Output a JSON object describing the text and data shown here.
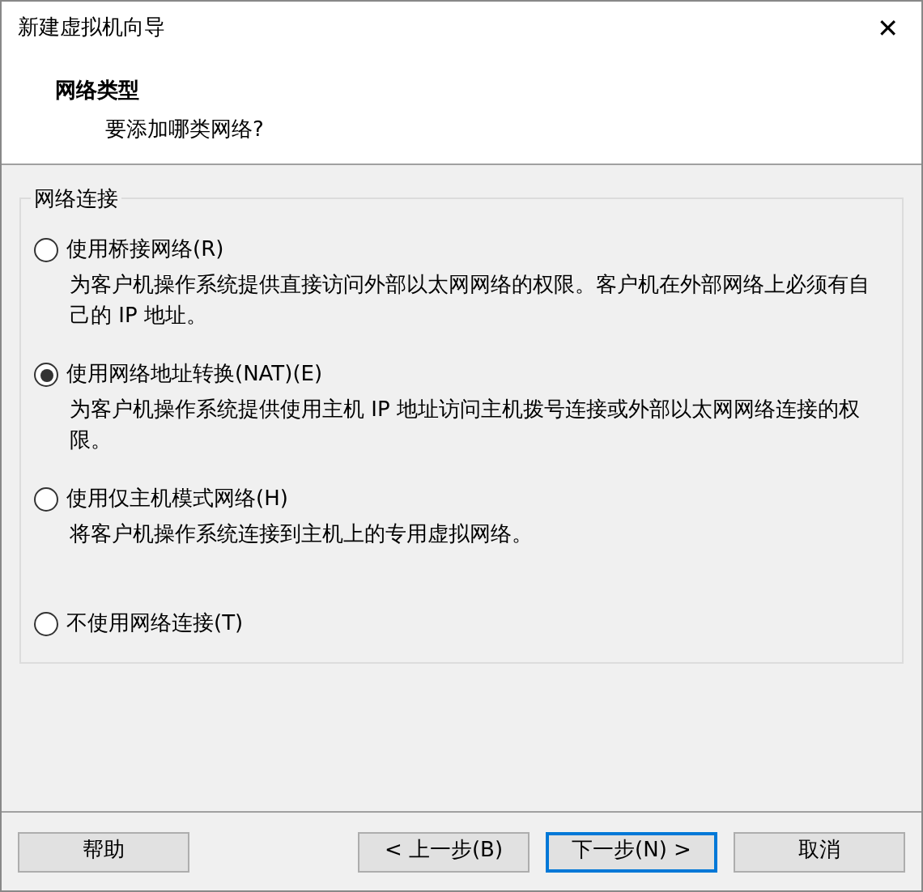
{
  "window": {
    "title": "新建虚拟机向导",
    "close_glyph": "✕"
  },
  "header": {
    "title": "网络类型",
    "subtitle": "要添加哪类网络?"
  },
  "group": {
    "legend": "网络连接",
    "options": [
      {
        "label": "使用桥接网络(R)",
        "description": "为客户机操作系统提供直接访问外部以太网网络的权限。客户机在外部网络上必须有自己的 IP 地址。",
        "selected": false
      },
      {
        "label": "使用网络地址转换(NAT)(E)",
        "description": "为客户机操作系统提供使用主机 IP 地址访问主机拨号连接或外部以太网网络连接的权限。",
        "selected": true
      },
      {
        "label": "使用仅主机模式网络(H)",
        "description": "将客户机操作系统连接到主机上的专用虚拟网络。",
        "selected": false
      },
      {
        "label": "不使用网络连接(T)",
        "selected": false
      }
    ]
  },
  "buttons": [
    {
      "label": "帮助",
      "focused": false
    },
    {
      "label": "< 上一步(B)",
      "focused": false
    },
    {
      "label": "下一步(N) >",
      "focused": true
    },
    {
      "label": "取消",
      "focused": false
    }
  ]
}
